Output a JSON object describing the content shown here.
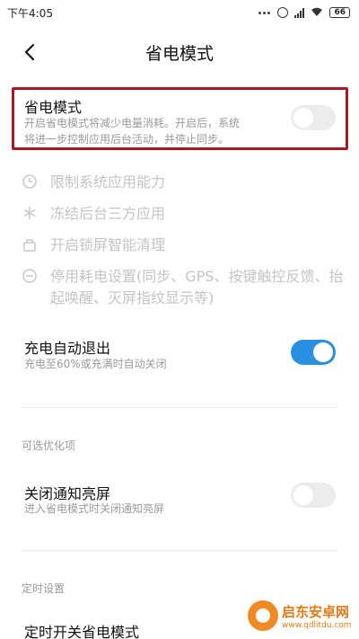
{
  "status_bar": {
    "time": "下午4:05",
    "battery": "66"
  },
  "header": {
    "title": "省电模式"
  },
  "power_saving": {
    "title": "省电模式",
    "description_line1": "开启省电模式将减少电量消耗。开启后，系统",
    "description_line2": "将进一步控制应用后台活动，并停止同步。",
    "enabled": false
  },
  "features": [
    {
      "icon": "clock-icon",
      "label": "限制系统应用能力"
    },
    {
      "icon": "snowflake-icon",
      "label": "冻结后台三方应用"
    },
    {
      "icon": "lock-clean-icon",
      "label": "开启锁屏智能清理"
    },
    {
      "icon": "minus-circle-icon",
      "label": "停用耗电设置(同步、GPS、按键触控反馈、抬起唤醒、灭屏指纹显示等)"
    }
  ],
  "auto_exit": {
    "title": "充电自动退出",
    "description": "充电至60%或充满时自动关闭",
    "enabled": true
  },
  "optional_section": {
    "label": "可选优化项"
  },
  "notification_light": {
    "title": "关闭通知亮屏",
    "description": "进入省电模式时关闭通知亮屏",
    "enabled": false
  },
  "schedule_section": {
    "label": "定时设置"
  },
  "schedule": {
    "title": "定时开关省电模式"
  },
  "watermark": {
    "name": "启东安卓网",
    "url": "www.qdlitdu.com"
  },
  "colors": {
    "accent": "#2a8fe0",
    "highlight": "#a71a24",
    "muted_text": "#9a9a9a",
    "disabled_text": "#c4c4c4"
  }
}
